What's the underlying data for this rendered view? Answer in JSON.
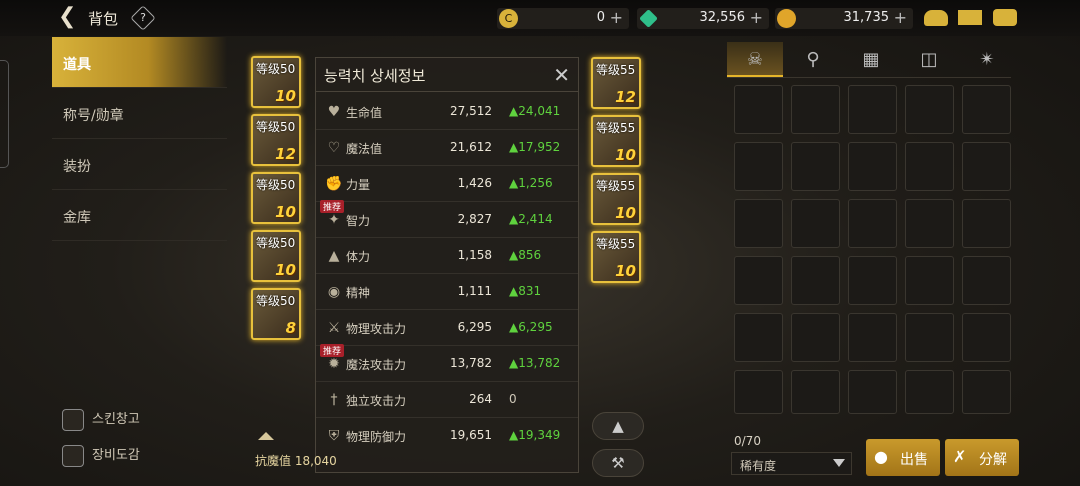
{
  "header": {
    "title": "背包",
    "help": "?"
  },
  "currencies": [
    {
      "name": "c-coin-icon",
      "value": "0",
      "color": "#d8b23a"
    },
    {
      "name": "green-gem-icon",
      "value": "32,556",
      "color": "#2fbf8a"
    },
    {
      "name": "gold-icon",
      "value": "31,735",
      "color": "#e0a52a"
    }
  ],
  "sidebar": {
    "items": [
      "道具",
      "称号/勋章",
      "装扮",
      "金库"
    ],
    "extra": [
      "스킨창고",
      "장비도감"
    ]
  },
  "left_slots": [
    {
      "level": "等级50",
      "count": "10"
    },
    {
      "level": "等级50",
      "count": "12"
    },
    {
      "level": "等级50",
      "count": "10"
    },
    {
      "level": "等级50",
      "count": "10"
    },
    {
      "level": "等级50",
      "count": "8"
    }
  ],
  "right_slots": [
    {
      "level": "等级55",
      "count": "12"
    },
    {
      "level": "等级55",
      "count": "10"
    },
    {
      "level": "等级55",
      "count": "10"
    },
    {
      "level": "等级55",
      "count": "10"
    }
  ],
  "popup": {
    "title": "능력치 상세정보",
    "recommend": "推荐",
    "rows": [
      {
        "icon": "heart-icon",
        "label": "生命值",
        "value": "27,512",
        "delta": "▲24,041"
      },
      {
        "icon": "heart-outline-icon",
        "label": "魔法值",
        "value": "21,612",
        "delta": "▲17,952"
      },
      {
        "icon": "fist-icon",
        "label": "力量",
        "value": "1,426",
        "delta": "▲1,256"
      },
      {
        "icon": "brain-icon",
        "label": "智力",
        "value": "2,827",
        "delta": "▲2,414",
        "rec": true
      },
      {
        "icon": "body-icon",
        "label": "体力",
        "value": "1,158",
        "delta": "▲856"
      },
      {
        "icon": "eye-icon",
        "label": "精神",
        "value": "1,111",
        "delta": "▲831"
      },
      {
        "icon": "sword-icon",
        "label": "物理攻击力",
        "value": "6,295",
        "delta": "▲6,295"
      },
      {
        "icon": "magic-icon",
        "label": "魔法攻击力",
        "value": "13,782",
        "delta": "▲13,782",
        "rec": true
      },
      {
        "icon": "dagger-icon",
        "label": "独立攻击力",
        "value": "264",
        "delta": "0"
      },
      {
        "icon": "shield-icon",
        "label": "物理防御力",
        "value": "19,651",
        "delta": "▲19,349"
      }
    ]
  },
  "resist": "抗魔值 18,040",
  "inventory": {
    "count": "0/70",
    "sort": "稀有度",
    "sell": "出售",
    "decompose": "分解"
  }
}
